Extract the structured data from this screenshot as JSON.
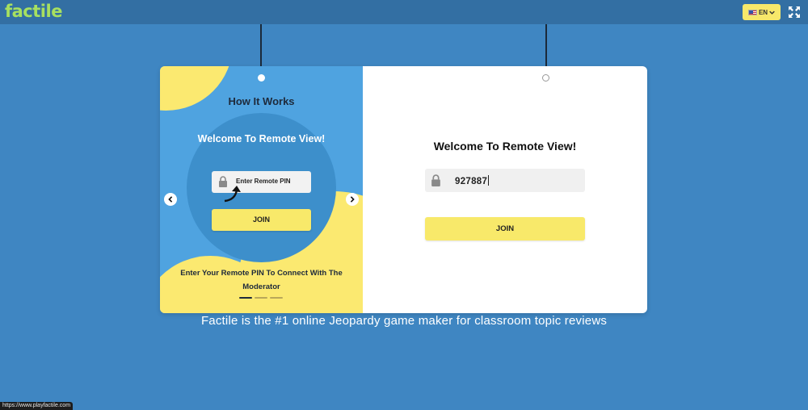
{
  "header": {
    "logo": "factile",
    "lang_label": "EN"
  },
  "colors": {
    "background": "#3f86c2",
    "topbar": "#336fa3",
    "accent_yellow": "#f8e96a",
    "logo_green": "#a7e060",
    "panel_blue": "#4fa3e0"
  },
  "icons": {
    "fullscreen": "expand-arrows-icon",
    "flag": "us-flag-icon",
    "lang_dropdown": "chevron-down-icon",
    "lock": "lock-icon",
    "prev": "chevron-left-icon",
    "next": "chevron-right-icon",
    "pointer": "curved-arrow-icon"
  },
  "how_it_works": {
    "title": "How It Works",
    "circle_title": "Welcome To Remote View!",
    "mini_input_placeholder": "Enter Remote PIN",
    "mini_join_label": "JOIN",
    "caption": "Enter Your Remote PIN To Connect With The Moderator",
    "slide_count": 3,
    "active_slide": 1
  },
  "remote_view": {
    "title": "Welcome To Remote View!",
    "pin_value": "927887",
    "join_label": "JOIN"
  },
  "footer": {
    "tagline": "Factile is the #1 online Jeopardy game maker for classroom topic reviews",
    "status_url": "https://www.playfactile.com"
  }
}
